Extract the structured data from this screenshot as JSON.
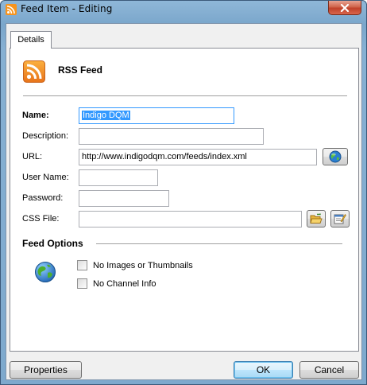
{
  "window": {
    "title": "Feed Item - Editing"
  },
  "tabs": [
    {
      "label": "Details"
    }
  ],
  "header": {
    "title": "RSS Feed"
  },
  "form": {
    "name": {
      "label": "Name:",
      "value": "Indigo DQM"
    },
    "description": {
      "label": "Description:",
      "value": ""
    },
    "url": {
      "label": "URL:",
      "value": "http://www.indigodqm.com/feeds/index.xml"
    },
    "username": {
      "label": "User Name:",
      "value": ""
    },
    "password": {
      "label": "Password:",
      "value": ""
    },
    "cssfile": {
      "label": "CSS File:",
      "value": ""
    }
  },
  "feed_options": {
    "title": "Feed Options",
    "checkboxes": [
      {
        "label": "No Images or Thumbnails",
        "checked": false
      },
      {
        "label": "No Channel Info",
        "checked": false
      }
    ]
  },
  "buttons": {
    "properties": "Properties",
    "ok": "OK",
    "cancel": "Cancel"
  },
  "colors": {
    "rss_orange": "#f7941d",
    "selection": "#3399ff",
    "close_red": "#c0412a"
  }
}
